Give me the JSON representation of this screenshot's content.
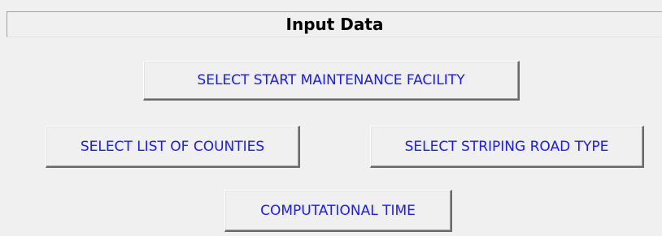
{
  "panel": {
    "title": "Input Data"
  },
  "buttons": {
    "select_start_facility": "SELECT START MAINTENANCE FACILITY",
    "select_counties": "SELECT LIST OF COUNTIES",
    "select_striping_road_type": "SELECT STRIPING ROAD TYPE",
    "computational_time": "COMPUTATIONAL TIME"
  },
  "colors": {
    "background": "#f0f0f0",
    "button_text": "#1a1aff",
    "title_text": "#000000"
  }
}
